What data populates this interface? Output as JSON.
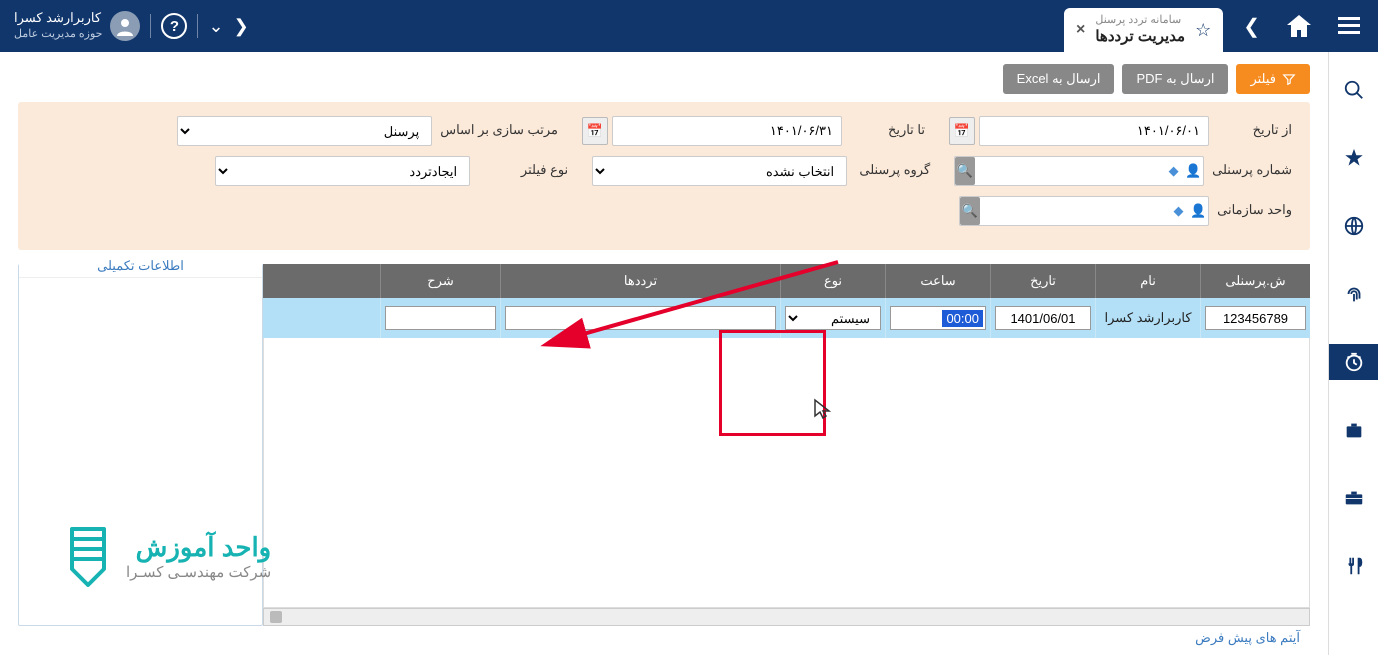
{
  "header": {
    "tab_sub": "سامانه تردد پرسنل",
    "tab_main": "مدیریت ترددها",
    "user_name": "کاربرارشد کسرا",
    "user_sub": "حوزه مدیریت عامل"
  },
  "actions": {
    "filter": "فیلتر",
    "pdf": "ارسال به PDF",
    "excel": "ارسال به Excel"
  },
  "filters": {
    "from_date_label": "از تاریخ",
    "from_date": "۱۴۰۱/۰۶/۰۱",
    "to_date_label": "تا تاریخ",
    "to_date": "۱۴۰۱/۰۶/۳۱",
    "sort_label": "مرتب سازی بر اساس",
    "sort_value": "پرسنل",
    "personnel_no_label": "شماره پرسنلی",
    "personnel_group_label": "گروه پرسنلی",
    "personnel_group_value": "انتخاب نشده",
    "filter_type_label": "نوع فیلتر",
    "filter_type_value": "ایجادتردد",
    "org_unit_label": "واحد سازمانی"
  },
  "grid": {
    "headers": {
      "id": "ش.پرسنلی",
      "name": "نام",
      "date": "تاریخ",
      "time": "ساعت",
      "type": "نوع",
      "trd": "ترددها",
      "desc": "شرح"
    },
    "row": {
      "id": "123456789",
      "name": "کاربرارشد کسرا",
      "date": "1401/06/01",
      "time": "00:00",
      "type": "سیستم"
    }
  },
  "side_panel_title": "اطلاعات تکمیلی",
  "default_items_label": "آیتم های پیش فرض",
  "logo": {
    "main": "واحد آموزش",
    "sub": "شرکت مهندسـی کسـرا"
  }
}
